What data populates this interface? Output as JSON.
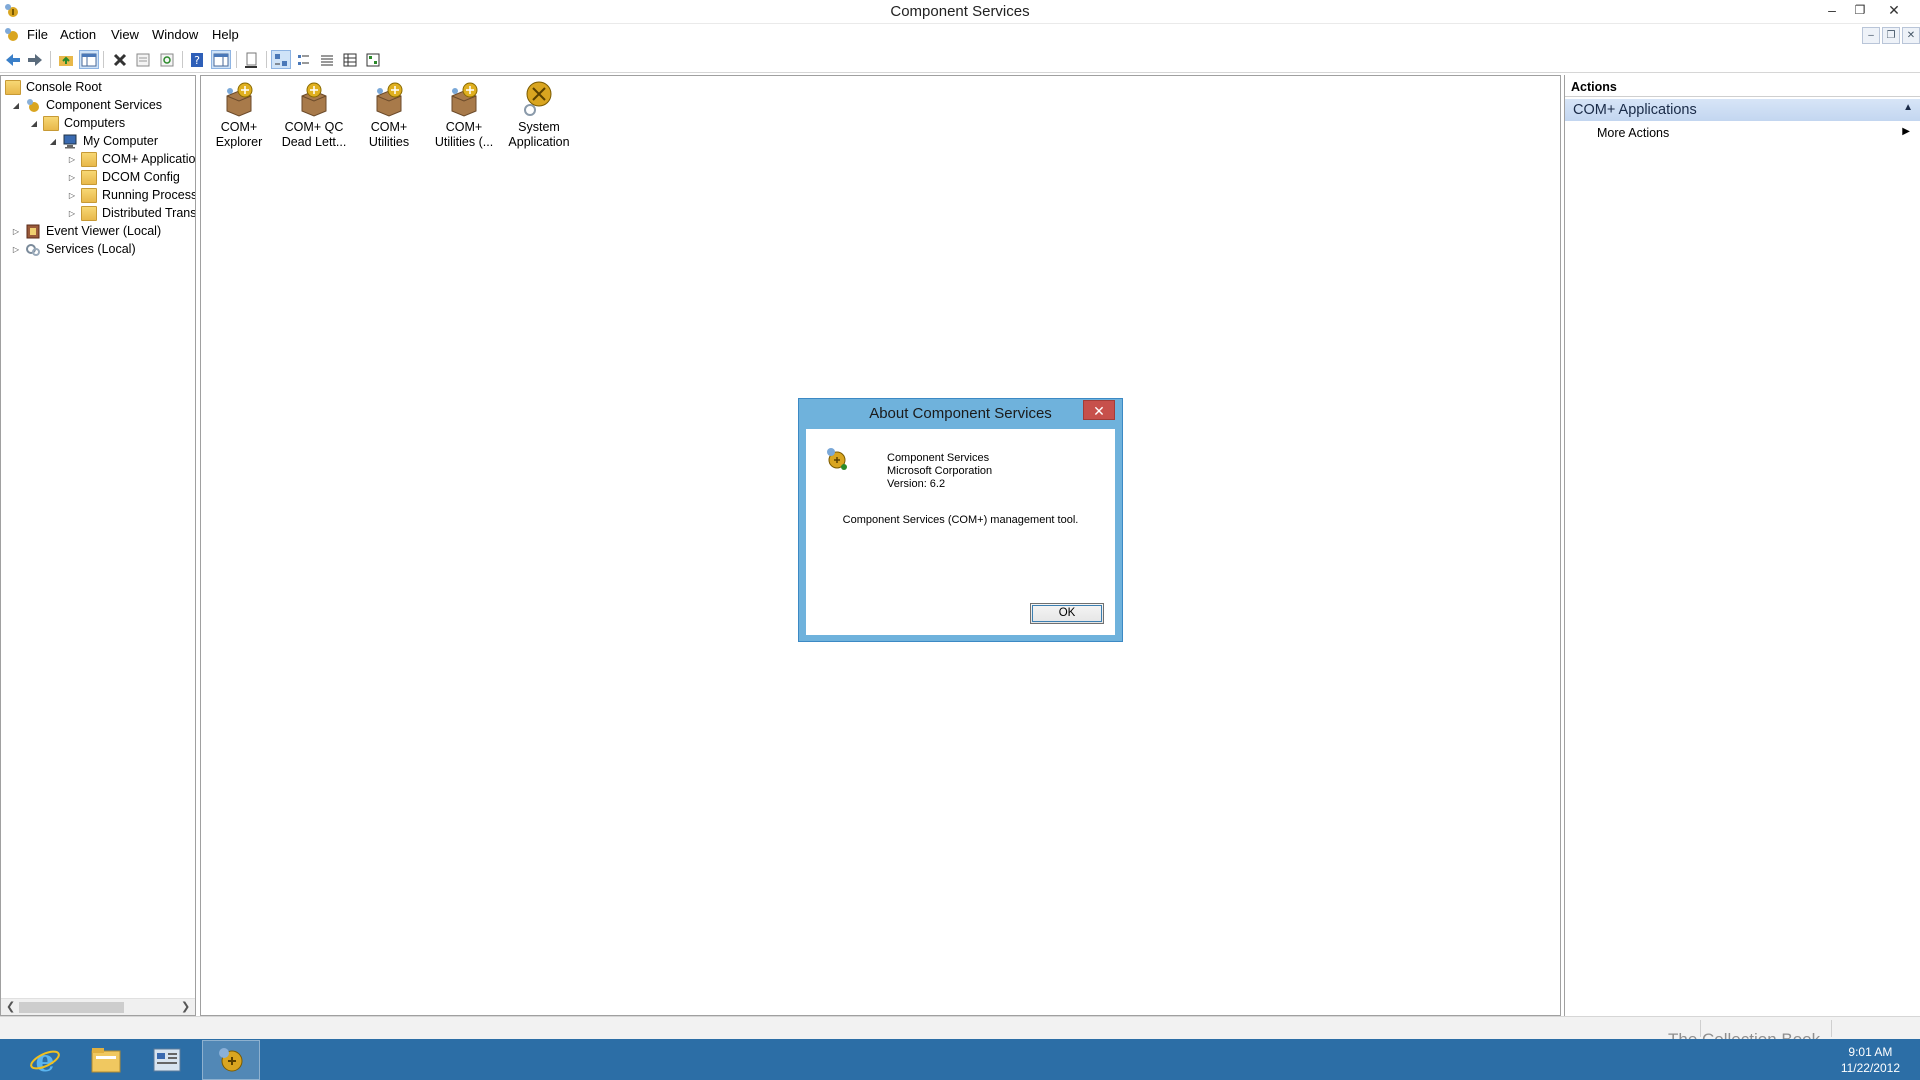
{
  "window": {
    "title": "Component Services",
    "minimize": "–",
    "restore": "❐",
    "close": "✕"
  },
  "menu": {
    "items": [
      "File",
      "Action",
      "View",
      "Window",
      "Help"
    ],
    "mdi_minimize": "–",
    "mdi_restore": "❐",
    "mdi_close": "✕"
  },
  "toolbar": {
    "buttons": [
      "back-icon",
      "forward-icon",
      "up-folder-icon",
      "show-hide-tree-icon",
      "delete-icon",
      "properties-icon",
      "refresh-icon",
      "help-icon",
      "show-hide-action-pane-icon",
      "export-list-icon",
      "large-icons-view-icon",
      "small-icons-view-icon",
      "list-view-icon",
      "detail-view-icon",
      "status-view-icon"
    ],
    "active": [
      "show-hide-tree-icon",
      "large-icons-view-icon"
    ]
  },
  "tree": {
    "items": [
      {
        "label": "Console Root",
        "level": 0,
        "expander": "",
        "icon": "folder-icon"
      },
      {
        "label": "Component Services",
        "level": 1,
        "expander": "◢",
        "icon": "component-services-icon"
      },
      {
        "label": "Computers",
        "level": 2,
        "expander": "◢",
        "icon": "folder-icon"
      },
      {
        "label": "My Computer",
        "level": 3,
        "expander": "◢",
        "icon": "computer-icon"
      },
      {
        "label": "COM+ Applicatio",
        "level": 4,
        "expander": "▷",
        "icon": "folder-icon"
      },
      {
        "label": "DCOM Config",
        "level": 4,
        "expander": "▷",
        "icon": "folder-icon"
      },
      {
        "label": "Running Processe",
        "level": 4,
        "expander": "▷",
        "icon": "folder-icon"
      },
      {
        "label": "Distributed Trans.",
        "level": 4,
        "expander": "▷",
        "icon": "folder-icon"
      },
      {
        "label": "Event Viewer (Local)",
        "level": 0,
        "expander": "▷",
        "icon": "event-viewer-icon"
      },
      {
        "label": "Services (Local)",
        "level": 0,
        "expander": "▷",
        "icon": "services-icon"
      }
    ]
  },
  "center": {
    "icons": [
      {
        "line1": "COM+",
        "line2": "Explorer",
        "icon": "com-package-icon"
      },
      {
        "line1": "COM+ QC",
        "line2": "Dead Lett...",
        "icon": "com-package-icon"
      },
      {
        "line1": "COM+",
        "line2": "Utilities",
        "icon": "com-package-icon"
      },
      {
        "line1": "COM+",
        "line2": "Utilities (...",
        "icon": "com-package-icon"
      },
      {
        "line1": "System",
        "line2": "Application",
        "icon": "system-application-icon"
      }
    ]
  },
  "actions": {
    "header": "Actions",
    "group": "COM+ Applications",
    "items": [
      "More Actions"
    ]
  },
  "dialog": {
    "title": "About Component Services",
    "close": "✕",
    "app_name": "Component Services",
    "company": "Microsoft Corporation",
    "version": "Version: 6.2",
    "description": "Component Services (COM+) management tool.",
    "ok": "OK"
  },
  "taskbar": {
    "apps": [
      "internet-explorer-icon",
      "file-explorer-icon",
      "server-manager-icon",
      "component-services-icon"
    ],
    "running": "component-services-icon",
    "time": "9:01 AM",
    "date": "11/22/2012"
  },
  "watermark": "The Collection Book",
  "colors": {
    "taskbar": "#2c6ea6",
    "dialog_frame": "#6fb2dc",
    "dialog_close": "#c7504b",
    "actions_group": "#c3d6f0"
  }
}
